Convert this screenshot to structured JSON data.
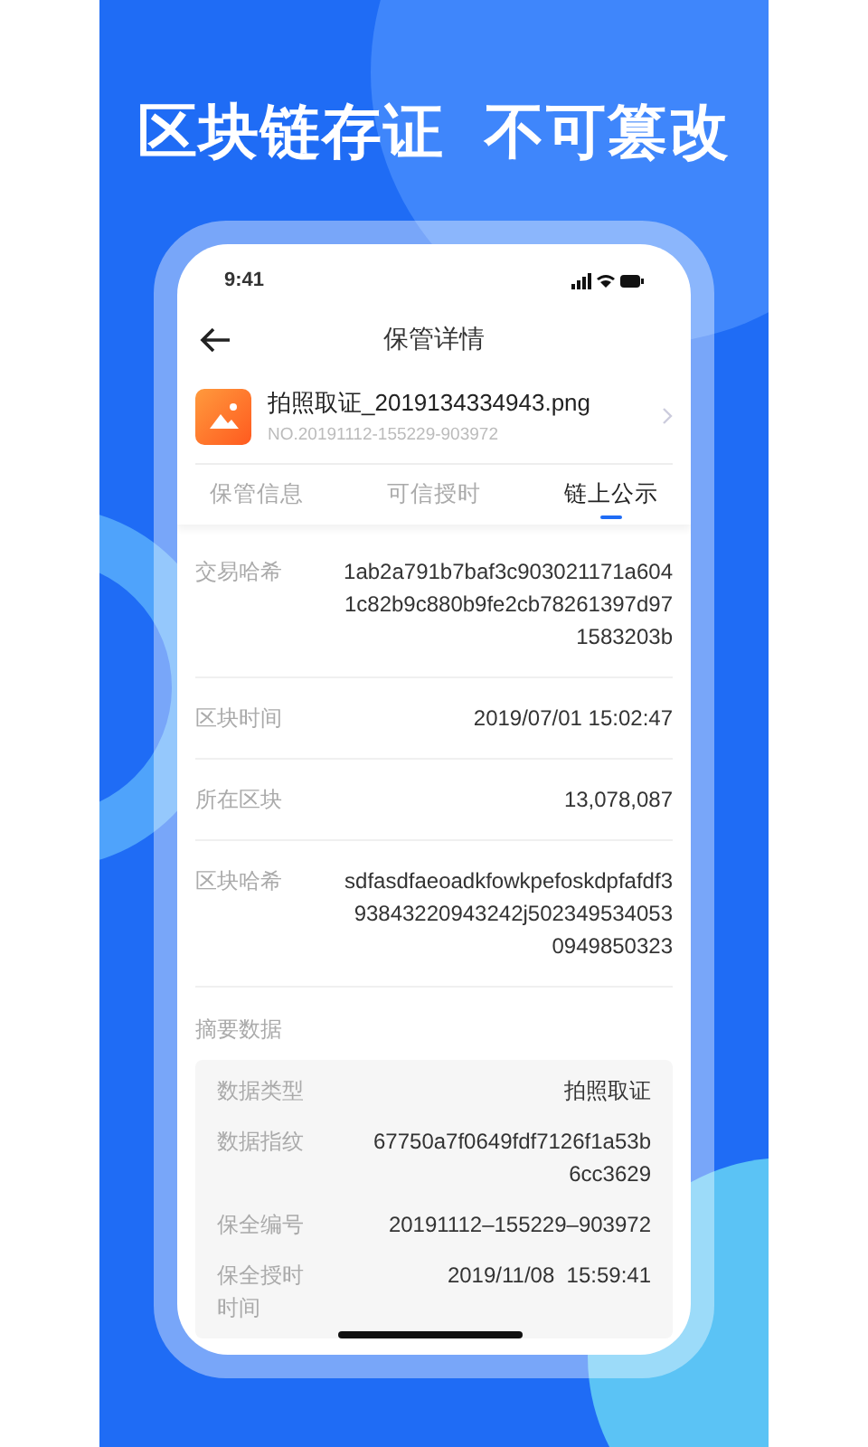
{
  "headline": [
    "区块链存证",
    "不可篡改"
  ],
  "status_bar": {
    "time": "9:41"
  },
  "nav": {
    "title": "保管详情"
  },
  "file": {
    "name": "拍照取证_2019134334943.png",
    "number": "NO.20191112-155229-903972"
  },
  "tabs": [
    {
      "label": "保管信息",
      "selected": false
    },
    {
      "label": "可信授时",
      "selected": false
    },
    {
      "label": "链上公示",
      "selected": true
    }
  ],
  "rows": [
    {
      "label": "交易哈希",
      "value": "1ab2a791b7baf3c903021171a6041c82b9c880b9fe2cb78261397d971583203b"
    },
    {
      "label": "区块时间",
      "value": "2019/07/01 15:02:47"
    },
    {
      "label": "所在区块",
      "value": "13,078,087"
    },
    {
      "label": "区块哈希",
      "value": "sdfasdfaeoadkfowkpefoskdpfafdf393843220943242j5023495340530949850323"
    }
  ],
  "summary": {
    "title": "摘要数据",
    "rows": [
      {
        "label": "数据类型",
        "value": "拍照取证"
      },
      {
        "label": "数据指纹",
        "value": "67750a7f0649fdf7126f1a53b6cc3629"
      },
      {
        "label": "保全编号",
        "value": "20191112–155229–903972"
      },
      {
        "label": "保全授时时间",
        "value": "2019/11/08  15:59:41"
      }
    ]
  }
}
